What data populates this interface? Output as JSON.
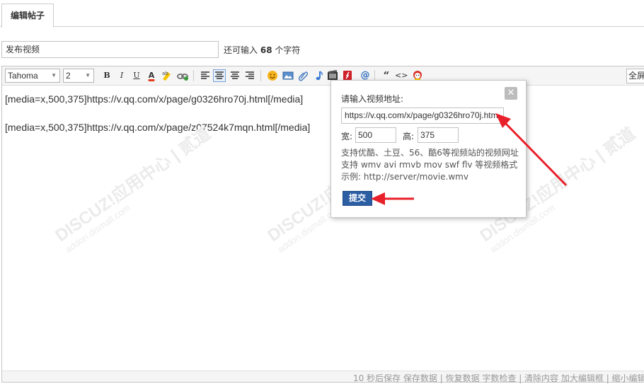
{
  "tab": {
    "label": "编辑帖子"
  },
  "title_field": {
    "value": "发布视频",
    "hint_prefix": "还可输入",
    "hint_count": "68",
    "hint_suffix": "个字符"
  },
  "toolbar": {
    "font_family": "Tahoma",
    "font_size": "2",
    "bold": "B",
    "italic": "I",
    "underline": "U",
    "font_color": "A",
    "quote": "“",
    "code": "<>",
    "fullscreen": "全屏"
  },
  "content": {
    "line1": "[media=x,500,375]https://v.qq.com/x/page/g0326hro70j.html[/media]",
    "line2": "[media=x,500,375]https://v.qq.com/x/page/z07524k7mqn.html[/media]"
  },
  "statusbar": {
    "text": "10 秒后保存 保存数据 | 恢复数据    字数检查 | 清除内容    加大编辑框 | 缩小编辑框"
  },
  "popup": {
    "label": "请输入视频地址:",
    "url_value": "https://v.qq.com/x/page/g0326hro70j.htm",
    "width_label": "宽:",
    "width_value": "500",
    "height_label": "高:",
    "height_value": "375",
    "help_line1": "支持优酷、土豆、56、酷6等视频站的视频网址",
    "help_line2": "支持 wmv avi rmvb mov swf flv 等视频格式",
    "help_line3": "示例: http://server/movie.wmv",
    "submit_label": "提交",
    "close_glyph": "✕"
  },
  "watermark": {
    "brand": "DISCUZ!应用中心 | 贰道",
    "sub": "addon.dismall.com"
  },
  "colors": {
    "submit_bg": "#2c5ea4",
    "arrow": "#e8202a"
  }
}
